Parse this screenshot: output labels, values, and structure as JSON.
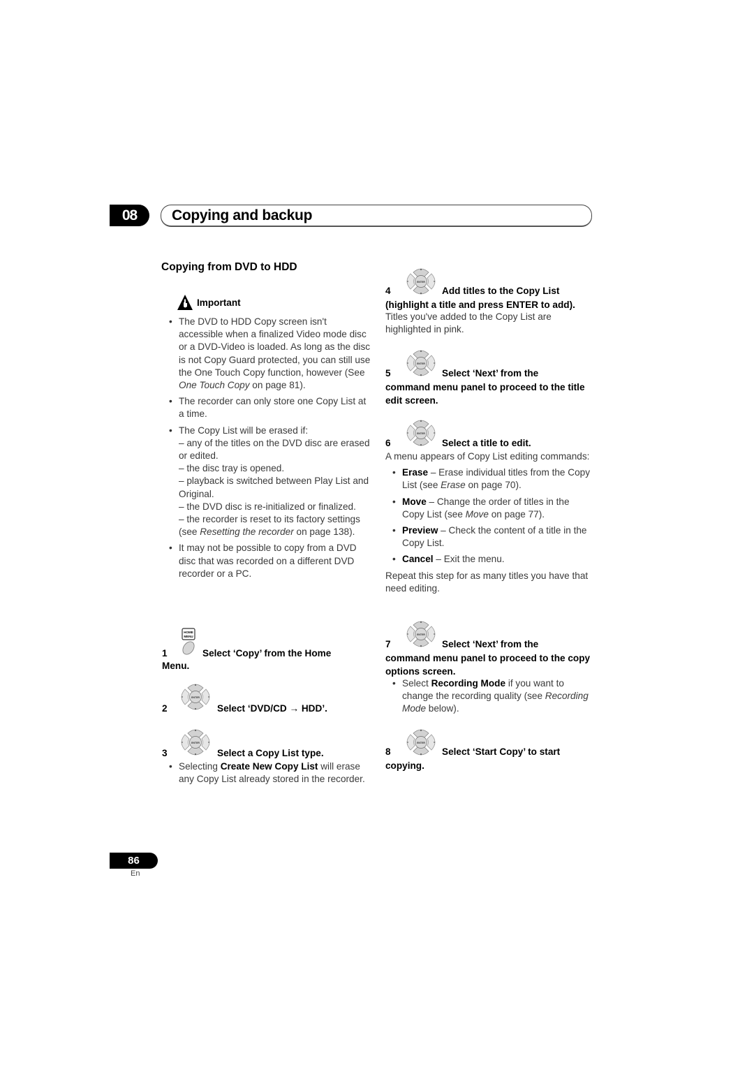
{
  "chapter": {
    "number": "08",
    "title": "Copying and backup"
  },
  "section_title": "Copying from DVD to HDD",
  "important": {
    "label": "Important",
    "bullets": [
      {
        "parts": [
          "The DVD to HDD Copy screen isn't accessible when a finalized Video mode disc or a DVD-Video is loaded. As long as the disc is not Copy Guard protected, you can still use the One Touch Copy function, however (See ",
          "One Touch Copy",
          " on page 81)."
        ]
      },
      {
        "text": "The recorder can only store one Copy List at a time."
      },
      {
        "intro": "The Copy List will be erased if:",
        "items": [
          "– any of the titles on the DVD disc are erased or edited.",
          "– the disc tray is opened.",
          "– playback is switched between Play List and Original.",
          "– the DVD disc is re-initialized or finalized."
        ],
        "last_parts": [
          "– the recorder is reset to its factory settings (see ",
          "Resetting the recorder",
          " on page 138)."
        ]
      },
      {
        "text": "It may not be possible to copy from a DVD disc that was recorded on a different DVD recorder or a PC."
      }
    ]
  },
  "steps": [
    {
      "num": "1",
      "icon": "home-menu-button",
      "icon_label": [
        "HOME",
        "MENU"
      ],
      "title": "Select ‘Copy’ from the Home",
      "title_cont": "Menu."
    },
    {
      "num": "2",
      "icon": "dpad-enter",
      "title": "Select ‘DVD/CD → HDD’."
    },
    {
      "num": "3",
      "icon": "dpad-enter",
      "title": "Select a Copy List type.",
      "bullet": [
        "Selecting ",
        "Create New Copy List",
        " will erase any Copy List already stored in the recorder."
      ]
    },
    {
      "num": "4",
      "icon": "dpad-enter",
      "title": "Add titles to the Copy List",
      "title_cont": "(highlight a title and press ENTER to add).",
      "body": "Titles you've added to the Copy List are highlighted in pink."
    },
    {
      "num": "5",
      "icon": "dpad-enter",
      "title": "Select ‘Next’ from the",
      "title_cont": "command menu panel to proceed to the title edit screen."
    },
    {
      "num": "6",
      "icon": "dpad-enter",
      "title": "Select a title to edit.",
      "body": "A menu appears of Copy List editing commands:",
      "commands": [
        {
          "name": "Erase",
          "parts": [
            " – Erase individual titles from the Copy List (see ",
            "Erase",
            " on page 70)."
          ]
        },
        {
          "name": "Move",
          "parts": [
            " – Change the order of titles in the Copy List (see ",
            "Move",
            " on page 77)."
          ]
        },
        {
          "name": "Preview",
          "parts": [
            " – Check the content of a title in the Copy List.",
            "",
            ""
          ]
        },
        {
          "name": "Cancel",
          "parts": [
            " – Exit the menu.",
            "",
            ""
          ]
        }
      ],
      "after": "Repeat this step for as many titles you have that need editing."
    },
    {
      "num": "7",
      "icon": "dpad-enter",
      "title": "Select ‘Next’ from the",
      "title_cont": "command menu panel to proceed to the copy options screen.",
      "bullet": [
        "Select ",
        "Recording Mode",
        " if you want to change the recording quality (see ",
        "Recording Mode",
        " below)."
      ]
    },
    {
      "num": "8",
      "icon": "dpad-enter",
      "title": "Select ‘Start Copy’ to start",
      "title_cont": "copying."
    }
  ],
  "dpad_center_label": "ENTER",
  "footer": {
    "page": "86",
    "lang": "En"
  }
}
